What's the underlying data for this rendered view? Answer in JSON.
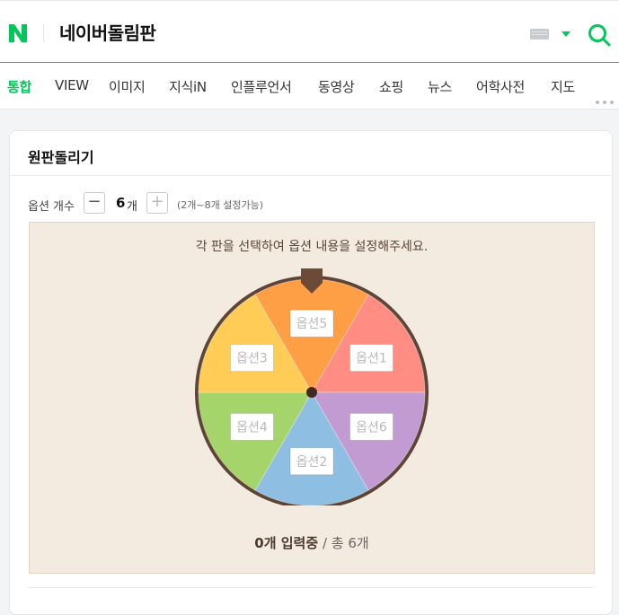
{
  "header": {
    "logo_letter": "N",
    "query": "네이버돌림판",
    "brand_color": "#03c75a",
    "keyboard_icon": "keyboard-icon",
    "dropdown_icon": "caret-down-icon",
    "search_icon": "search-icon"
  },
  "tabs": [
    {
      "label": "통합",
      "active": true
    },
    {
      "label": "VIEW",
      "active": false
    },
    {
      "label": "이미지",
      "active": false
    },
    {
      "label": "지식iN",
      "active": false
    },
    {
      "label": "인플루언서",
      "active": false
    },
    {
      "label": "동영상",
      "active": false
    },
    {
      "label": "쇼핑",
      "active": false
    },
    {
      "label": "뉴스",
      "active": false
    },
    {
      "label": "어학사전",
      "active": false
    },
    {
      "label": "지도",
      "active": false
    }
  ],
  "more_icon": "more-dots-icon",
  "card": {
    "title": "원판돌리기",
    "option_label": "옵션 개수",
    "minus_label": "−",
    "plus_label": "+",
    "count_value": "6",
    "count_unit": "개",
    "range_hint": "(2개~8개 설정가능)",
    "instruction": "각 판을 선택하여 옵션 내용을 설정해주세요.",
    "status_count": "0개 입력중",
    "status_total": " / 총 6개"
  },
  "wheel": {
    "segments": [
      {
        "label": "옵션1",
        "color": "#ff8d84"
      },
      {
        "label": "옵션6",
        "color": "#c39bd3"
      },
      {
        "label": "옵션2",
        "color": "#8ebfe3"
      },
      {
        "label": "옵션4",
        "color": "#a4d46a"
      },
      {
        "label": "옵션3",
        "color": "#ffcc55"
      },
      {
        "label": "옵션5",
        "color": "#ff9f45"
      }
    ],
    "rim_color": "#5c4537",
    "pointer_color": "#6b4a38"
  }
}
